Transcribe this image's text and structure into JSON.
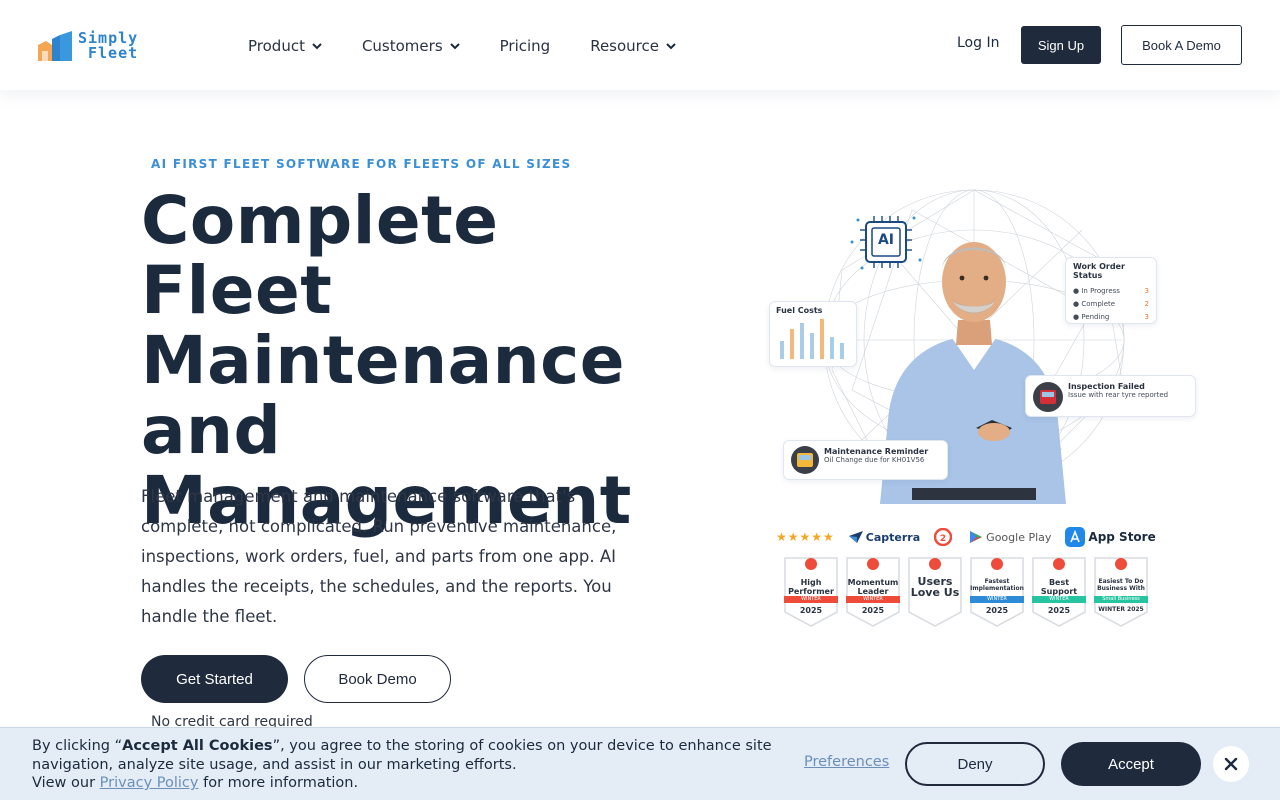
{
  "header": {
    "logo": {
      "line1": "Simply",
      "line2": "Fleet"
    },
    "nav": [
      {
        "label": "Product",
        "dropdown": true
      },
      {
        "label": "Customers",
        "dropdown": true
      },
      {
        "label": "Pricing",
        "dropdown": false
      },
      {
        "label": "Resource",
        "dropdown": true
      }
    ],
    "login": "Log In",
    "signup": "Sign Up",
    "book_demo": "Book A Demo"
  },
  "hero": {
    "eyebrow": "AI FIRST FLEET SOFTWARE FOR FLEETS OF ALL SIZES",
    "title_lines": [
      "Complete Fleet",
      "Maintenance",
      "and",
      "Management"
    ],
    "description": "Fleet management and maintenance software that's complete, not complicated. Run preventive maintenance, inspections, work orders, fuel, and parts from one app. AI handles the receipts, the schedules, and the reports. You handle the fleet.",
    "cta_primary": "Get Started",
    "cta_secondary": "Book Demo",
    "note": "No credit card required"
  },
  "illustration": {
    "ai_chip": "AI",
    "fuel_card": {
      "title": "Fuel Costs"
    },
    "work_order": {
      "title": "Work Order Status",
      "rows": [
        {
          "label": "In Progress",
          "count": "3",
          "color": "#e8742c"
        },
        {
          "label": "Complete",
          "count": "2",
          "color": "#e8742c"
        },
        {
          "label": "Pending",
          "count": "3",
          "color": "#e8742c"
        }
      ]
    },
    "inspection": {
      "title": "Inspection Failed",
      "sub": "Issue with rear tyre reported"
    },
    "maintenance": {
      "title": "Maintenance Reminder",
      "sub": "Oil Change due for KH01V56"
    }
  },
  "ratings": {
    "stars": "★★★★★",
    "brands": [
      "Capterra",
      "Google Play",
      "App Store"
    ],
    "g2_badges": [
      {
        "title": "High Performer",
        "band": "WINTER",
        "year": "2025",
        "band_color": "#ef4b3a"
      },
      {
        "title": "Momentum Leader",
        "band": "WINTER",
        "year": "2025",
        "band_color": "#ef4b3a"
      },
      {
        "title": "Users Love Us",
        "band": "",
        "year": "",
        "band_color": "#ffffff"
      },
      {
        "title": "Fastest Implementation",
        "band": "WINTER",
        "year": "2025",
        "band_color": "#2e8bd8"
      },
      {
        "title": "Best Support",
        "band": "WINTER",
        "year": "2025",
        "band_color": "#27c4a2"
      },
      {
        "title": "Easiest To Do Business With",
        "band": "Small Business",
        "year": "WINTER 2025",
        "band_color": "#27c4a2"
      }
    ]
  },
  "cookie": {
    "prefix": "By clicking “",
    "emphasis": "Accept All Cookies",
    "suffix": "”, you agree to the storing of cookies on your device to enhance site navigation, analyze site usage, and assist in our marketing efforts.",
    "view_our": "View our",
    "privacy_link": "Privacy Policy",
    "more_info": "for more information.",
    "preferences": "Preferences",
    "deny": "Deny",
    "accept": "Accept"
  },
  "colors": {
    "navy": "#1f2a3d",
    "accent_blue": "#3a8fd6",
    "cookie_bg": "#e4edf6"
  }
}
